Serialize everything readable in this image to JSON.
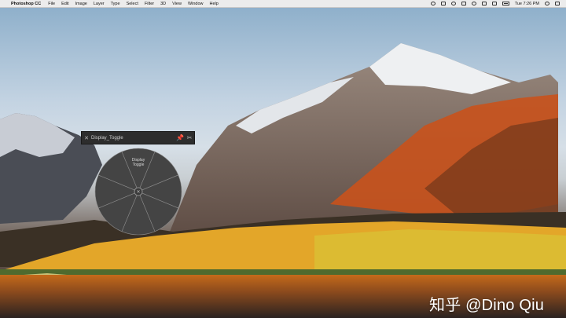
{
  "menubar": {
    "apple": "",
    "app_name": "Photoshop CC",
    "items": [
      "File",
      "Edit",
      "Image",
      "Layer",
      "Type",
      "Select",
      "Filter",
      "3D",
      "View",
      "Window",
      "Help"
    ],
    "clock": "Tue 7:26 PM"
  },
  "panel": {
    "title": "Display_Toggle",
    "close_glyph": "✕",
    "pin_glyph": "📌",
    "tools_glyph": "✂"
  },
  "wheel": {
    "segment_label_line1": "Display",
    "segment_label_line2": "Toggle",
    "center_glyph": "✕",
    "segment_count": 8,
    "fill": "#444444",
    "line": "#8a8a8a"
  },
  "watermark": "知乎 @Dino Qiu"
}
